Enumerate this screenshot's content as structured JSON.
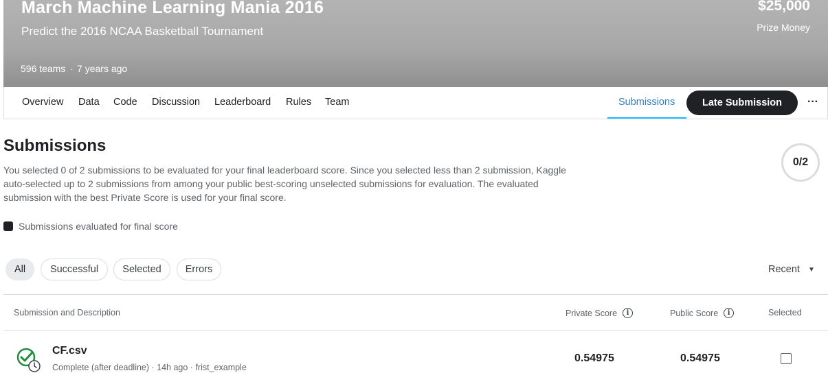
{
  "banner": {
    "title": "March Machine Learning Mania 2016",
    "subtitle": "Predict the 2016 NCAA Basketball Tournament",
    "teams": "596 teams",
    "age": "7 years ago",
    "prize": "$25,000",
    "prize_label": "Prize Money"
  },
  "tabs": {
    "items": [
      "Overview",
      "Data",
      "Code",
      "Discussion",
      "Leaderboard",
      "Rules",
      "Team"
    ],
    "active": "Submissions",
    "late_button": "Late Submission",
    "more": "···"
  },
  "submissions": {
    "title": "Submissions",
    "description": "You selected 0 of 2 submissions to be evaluated for your final leaderboard score. Since you selected less than 2 submission, Kaggle auto-selected up to 2 submissions from among your public best-scoring unselected submissions for evaluation. The evaluated submission with the best Private Score is used for your final score.",
    "counter": "0/2",
    "legend": "Submissions evaluated for final score"
  },
  "filters": {
    "chips": [
      "All",
      "Successful",
      "Selected",
      "Errors"
    ],
    "active": "All",
    "sort": "Recent"
  },
  "table": {
    "headers": {
      "submission": "Submission and Description",
      "private": "Private Score",
      "public": "Public Score",
      "selected": "Selected"
    },
    "rows": [
      {
        "file": "CF.csv",
        "meta": "Complete (after deadline) · 14h ago · frist_example",
        "private_score": "0.54975",
        "public_score": "0.54975",
        "selected": false
      }
    ]
  },
  "colors": {
    "accent": "#20beff",
    "success": "#1e8e3e",
    "dark": "#202124"
  }
}
